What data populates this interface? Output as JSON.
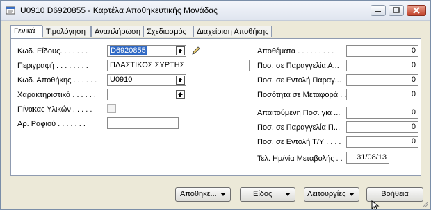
{
  "window": {
    "title": "U0910 D6920855 - Καρτέλα Αποθηκευτικής Μονάδας"
  },
  "tabs": [
    {
      "label": "Γενικά",
      "active": true
    },
    {
      "label": "Τιμολόγηση",
      "active": false
    },
    {
      "label": "Αναπλήρωση",
      "active": false
    },
    {
      "label": "Σχεδιασμός",
      "active": false
    },
    {
      "label": "Διαχείριση Αποθήκης",
      "active": false
    }
  ],
  "left_fields": [
    {
      "label": "Κωδ. Είδους. . . . . . .",
      "value": "D6920855"
    },
    {
      "label": "Περιγραφή . . . . . . . .",
      "value": "ΠΛΑΣΤΙΚΟΣ ΣΥΡΤΗΣ"
    },
    {
      "label": "Κωδ. Αποθήκης . . . . . .",
      "value": "U0910"
    },
    {
      "label": "Χαρακτηριστικά . . . . . .",
      "value": ""
    },
    {
      "label": "Πίνακας Υλικών . . . . .",
      "value": ""
    },
    {
      "label": "Αρ. Ραφιού . . . . . . .",
      "value": ""
    }
  ],
  "right_fields": [
    {
      "label": "Αποθέματα . . . . . . . . .",
      "value": "0"
    },
    {
      "label": "Ποσ. σε Παραγγελία Α...",
      "value": "0"
    },
    {
      "label": "Ποσ. σε Εντολή Παραγ...",
      "value": "0"
    },
    {
      "label": "Ποσότητα σε Μεταφορά . .",
      "value": "0"
    },
    {
      "label": "Απαιτούμενη Ποσ. για ...",
      "value": "0"
    },
    {
      "label": "Ποσ. σε Παραγγελία Π...",
      "value": "0"
    },
    {
      "label": "Ποσ. σε Εντολή Τ/Υ . . . .",
      "value": "0"
    },
    {
      "label": "Τελ. Ημ/νία Μεταβολής . .",
      "value": "31/08/13"
    }
  ],
  "buttons": {
    "warehouse": "Αποθηκε...",
    "item": "Είδος",
    "functions": "Λειτουργίες",
    "help": "Βοήθεια"
  }
}
